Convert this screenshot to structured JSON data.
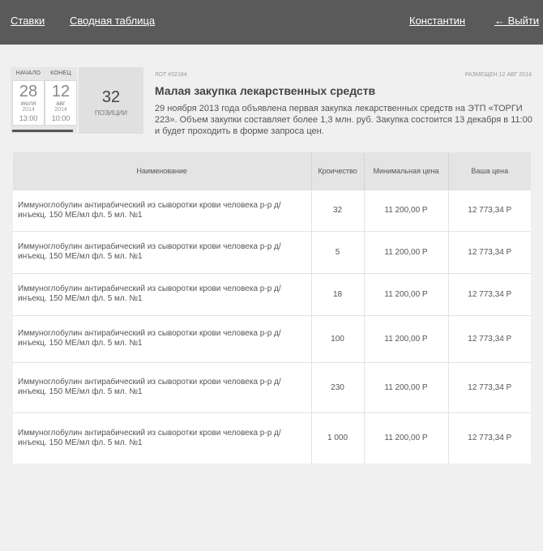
{
  "nav": {
    "bets": "Ставки",
    "summary": "Сводная таблица",
    "user": "Константин",
    "logout": "← Выйти"
  },
  "lot": {
    "start": {
      "label": "Начало",
      "day": "28",
      "month": "июля",
      "year": "2014",
      "time": "13:00"
    },
    "end": {
      "label": "Конец",
      "day": "12",
      "month": "авг",
      "year": "2014",
      "time": "10:00"
    },
    "positions_count": "32",
    "positions_label": "Позиции",
    "id": "Лот #32184",
    "posted": "Размещен 12 авг 2014",
    "title": "Малая закупка лекарственных средств",
    "description": "29 ноября 2013 года объявлена первая закупка лекарственных средств на ЭТП «ТОРГИ 223». Объем закупки составляет более 1,3 млн. руб. Закупка состоится 13 декабря в 11:00 и будет проходить в форме запроса цен."
  },
  "table": {
    "headers": [
      "Наименование",
      "Кроичество",
      "Минимальная цена",
      "Ваша цена"
    ],
    "rows": [
      {
        "name": "Иммуноглобулин антирабический из сыворотки крови человека р-р д/инъекц. 150 МЕ/мл фл. 5 мл. №1",
        "qty": "32",
        "min_price": "11 200,00 Р",
        "your_price": "12 773,34 Р"
      },
      {
        "name": "Иммуноглобулин антирабический из сыворотки крови человека р-р д/инъекц. 150 МЕ/мл фл. 5 мл. №1",
        "qty": "5",
        "min_price": "11 200,00 Р",
        "your_price": "12 773,34 Р"
      },
      {
        "name": "Иммуноглобулин антирабический из сыворотки крови человека р-р д/инъекц. 150 МЕ/мл фл. 5 мл. №1",
        "qty": "18",
        "min_price": "11 200,00 Р",
        "your_price": "12 773,34 Р"
      },
      {
        "name": "Иммуноглобулин антирабический из сыворотки крови человека р-р д/инъекц. 150 МЕ/мл фл. 5 мл. №1",
        "qty": "100",
        "min_price": "11 200,00 Р",
        "your_price": "12 773,34 Р"
      },
      {
        "name": "Иммуноглобулин антирабический из сыворотки крови человека р-р д/инъекц. 150 МЕ/мл фл. 5 мл. №1",
        "qty": "230",
        "min_price": "11 200,00 Р",
        "your_price": "12 773,34 Р"
      },
      {
        "name": "Иммуноглобулин антирабический из сыворотки крови человека р-р д/инъекц. 150 МЕ/мл фл. 5 мл. №1",
        "qty": "1 000",
        "min_price": "11 200,00 Р",
        "your_price": "12 773,34 Р"
      }
    ]
  }
}
